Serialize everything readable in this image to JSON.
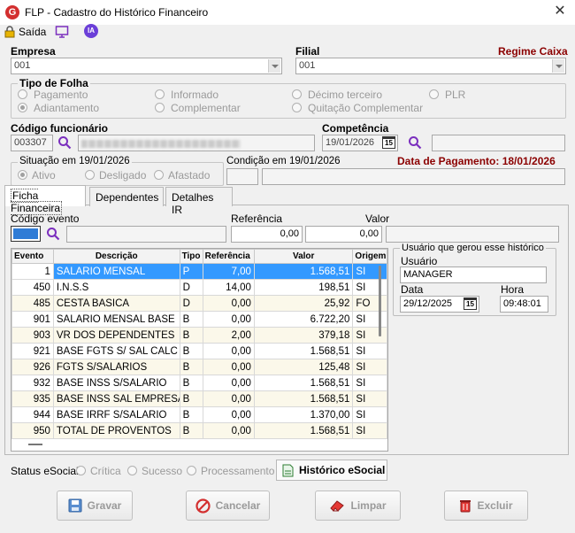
{
  "window": {
    "title": "FLP - Cadastro do Histórico Financeiro",
    "app_letter": "G"
  },
  "toolbar": {
    "saida_label": "Saída",
    "ia_label": "IA"
  },
  "empresa": {
    "label": "Empresa",
    "value": "001"
  },
  "filial": {
    "label": "Filial",
    "value": "001"
  },
  "regime": {
    "label": "Regime Caixa"
  },
  "tipo_folha": {
    "title": "Tipo de Folha",
    "options": [
      "Pagamento",
      "Informado",
      "Décimo terceiro",
      "PLR",
      "Adiantamento",
      "Complementar",
      "Quitação Complementar"
    ],
    "selected": "Adiantamento"
  },
  "funcionario": {
    "label": "Código funcionário",
    "code": "003307"
  },
  "competencia": {
    "label": "Competência",
    "value": "19/01/2026",
    "cal_label": "15"
  },
  "situacao": {
    "title": "Situação em 19/01/2026",
    "options": [
      "Ativo",
      "Desligado",
      "Afastado"
    ],
    "selected": "Ativo"
  },
  "condicao": {
    "label": "Condição em 19/01/2026"
  },
  "pagamento": {
    "label": "Data de Pagamento: 18/01/2026"
  },
  "tabs": [
    {
      "label": "Ficha Financeira"
    },
    {
      "label": "Dependentes"
    },
    {
      "label": "Detalhes IR"
    }
  ],
  "evento_form": {
    "codigo_label": "Código evento",
    "referencia_label": "Referência",
    "referencia_value": "0,00",
    "valor_label": "Valor",
    "valor_value": "0,00"
  },
  "grid": {
    "columns": [
      "Evento",
      "Descrição",
      "Tipo",
      "Referência",
      "Valor",
      "Origem"
    ],
    "rows": [
      {
        "evento": "1",
        "descricao": "SALARIO MENSAL",
        "tipo": "P",
        "referencia": "7,00",
        "valor": "1.568,51",
        "origem": "SI"
      },
      {
        "evento": "450",
        "descricao": "I.N.S.S",
        "tipo": "D",
        "referencia": "14,00",
        "valor": "198,51",
        "origem": "SI"
      },
      {
        "evento": "485",
        "descricao": "CESTA BASICA",
        "tipo": "D",
        "referencia": "0,00",
        "valor": "25,92",
        "origem": "FO"
      },
      {
        "evento": "901",
        "descricao": "SALARIO MENSAL BASE",
        "tipo": "B",
        "referencia": "0,00",
        "valor": "6.722,20",
        "origem": "SI"
      },
      {
        "evento": "903",
        "descricao": "VR DOS DEPENDENTES",
        "tipo": "B",
        "referencia": "2,00",
        "valor": "379,18",
        "origem": "SI"
      },
      {
        "evento": "921",
        "descricao": "BASE FGTS S/ SAL CALC",
        "tipo": "B",
        "referencia": "0,00",
        "valor": "1.568,51",
        "origem": "SI"
      },
      {
        "evento": "926",
        "descricao": "FGTS S/SALARIOS",
        "tipo": "B",
        "referencia": "0,00",
        "valor": "125,48",
        "origem": "SI"
      },
      {
        "evento": "932",
        "descricao": "BASE INSS S/SALARIO",
        "tipo": "B",
        "referencia": "0,00",
        "valor": "1.568,51",
        "origem": "SI"
      },
      {
        "evento": "935",
        "descricao": "BASE INSS SAL EMPRESA",
        "tipo": "B",
        "referencia": "0,00",
        "valor": "1.568,51",
        "origem": "SI"
      },
      {
        "evento": "944",
        "descricao": "BASE IRRF S/SALARIO",
        "tipo": "B",
        "referencia": "0,00",
        "valor": "1.370,00",
        "origem": "SI"
      },
      {
        "evento": "950",
        "descricao": "TOTAL DE PROVENTOS",
        "tipo": "B",
        "referencia": "0,00",
        "valor": "1.568,51",
        "origem": "SI"
      }
    ]
  },
  "usuario_box": {
    "title": "Usuário que gerou esse histórico",
    "usuario_label": "Usuário",
    "usuario_value": "MANAGER",
    "data_label": "Data",
    "data_value": "29/12/2025",
    "hora_label": "Hora",
    "hora_value": "09:48:01",
    "cal_label": "15"
  },
  "status": {
    "label": "Status eSocial:",
    "options": [
      "Crítica",
      "Sucesso",
      "Processamento"
    ],
    "historico_label": "Histórico eSocial"
  },
  "buttons": {
    "gravar": "Gravar",
    "cancelar": "Cancelar",
    "limpar": "Limpar",
    "excluir": "Excluir"
  },
  "colors": {
    "accent_red": "#8b0000",
    "selection": "#3399ff",
    "icon_purple": "#7b2fbe"
  }
}
